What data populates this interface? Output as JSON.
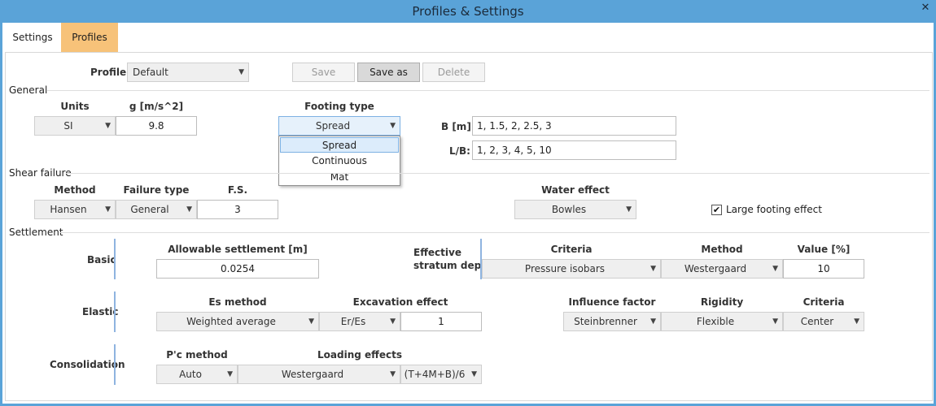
{
  "window": {
    "title": "Profiles & Settings",
    "close": "✕"
  },
  "tabs": [
    {
      "label": "Settings"
    },
    {
      "label": "Profiles"
    }
  ],
  "profile": {
    "label": "Profile:",
    "selected": "Default",
    "save": "Save",
    "save_as": "Save as",
    "delete": "Delete"
  },
  "general": {
    "section": "General",
    "units_label": "Units",
    "units_value": "SI",
    "g_label": "g [m/s^2]",
    "g_value": "9.8",
    "footing_label": "Footing type",
    "footing_value": "Spread",
    "footing_options": [
      "Spread",
      "Continuous",
      "Mat"
    ],
    "b_label": "B [m]:",
    "b_value": "1, 1.5, 2, 2.5, 3",
    "lb_label": "L/B:",
    "lb_value": "1, 2, 3, 4, 5, 10"
  },
  "shear": {
    "section": "Shear failure",
    "method_label": "Method",
    "method_value": "Hansen",
    "failure_label": "Failure type",
    "failure_value": "General",
    "fs_label": "F.S.",
    "fs_value": "3",
    "water_label": "Water effect",
    "water_value": "Bowles",
    "large_footing_label": "Large footing effect",
    "large_footing_checked": true
  },
  "settlement": {
    "section": "Settlement",
    "basic": {
      "label": "Basic",
      "allowable_label": "Allowable settlement [m]",
      "allowable_value": "0.0254",
      "effective_label_1": "Effective",
      "effective_label_2": "stratum depth",
      "criteria_label": "Criteria",
      "criteria_value": "Pressure isobars",
      "method_label": "Method",
      "method_value": "Westergaard",
      "value_label": "Value [%]",
      "value_value": "10"
    },
    "elastic": {
      "label": "Elastic",
      "es_label": "Es method",
      "es_value": "Weighted average",
      "excavation_label": "Excavation effect",
      "excavation_value": "Er/Es",
      "excavation_number": "1",
      "influence_label": "Influence factor",
      "influence_value": "Steinbrenner",
      "rigidity_label": "Rigidity",
      "rigidity_value": "Flexible",
      "criteria_label": "Criteria",
      "criteria_value": "Center"
    },
    "consolidation": {
      "label": "Consolidation",
      "pc_label": "P'c method",
      "pc_value": "Auto",
      "loading_label": "Loading effects",
      "loading_value": "Westergaard",
      "loading_formula": "(T+4M+B)/6"
    }
  },
  "icons": {
    "dropdown_arrow": "chevron-down-icon",
    "check": "✔"
  }
}
